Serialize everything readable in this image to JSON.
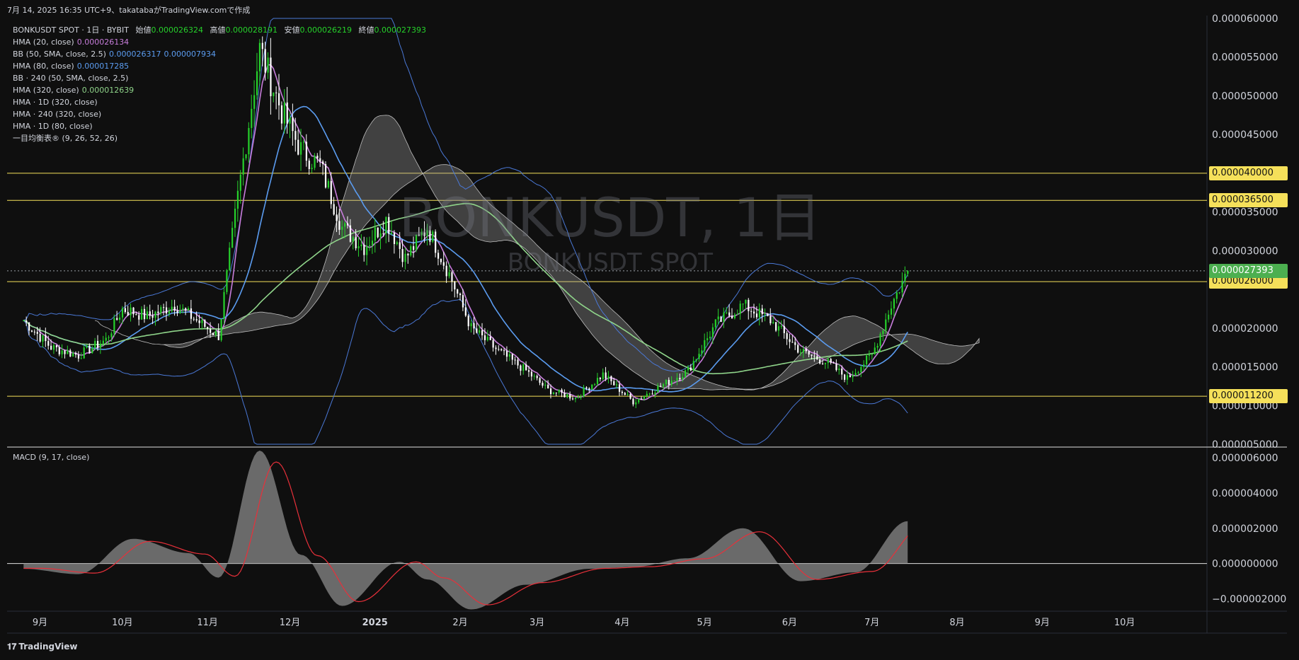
{
  "header": {
    "text": "7月 14, 2025 16:35 UTC+9、takatabaがTradingView.comで作成"
  },
  "legend": {
    "rows": [
      {
        "label": "BONKUSDT SPOT · 1日 · BYBIT",
        "parts": [
          {
            "label": "始値",
            "value": "0.000026324"
          },
          {
            "label": "高値",
            "value": "0.000028191"
          },
          {
            "label": "安値",
            "value": "0.000026219"
          },
          {
            "label": "終値",
            "value": "0.000027393"
          }
        ]
      },
      {
        "label": "HMA (20, close)",
        "value": "0.000026134",
        "color": "#c77ddb"
      },
      {
        "label": "BB (50, SMA, close, 2.5)",
        "value": "0.000026317",
        "value2": "0.000007934",
        "color": "#5b9cf0"
      },
      {
        "label": "HMA (80, close)",
        "value": "0.000017285",
        "color": "#5b9cf0"
      },
      {
        "label": "BB · 240 (50, SMA, close, 2.5)"
      },
      {
        "label": "HMA (320, close)",
        "value": "0.000012639",
        "color": "#8fd48a"
      },
      {
        "label": "HMA · 1D (320, close)"
      },
      {
        "label": "HMA · 240 (320, close)"
      },
      {
        "label": "HMA · 1D (80, close)"
      },
      {
        "label": "一目均衡表® (9, 26, 52, 26)"
      }
    ]
  },
  "macd_legend": "MACD (9, 17, close)",
  "watermark": {
    "line1": "BONKUSDT, 1日",
    "line2": "BONKUSDT SPOT"
  },
  "colors": {
    "up": "#26d12b",
    "down": "#ffffff",
    "hma20": "#c77ddb",
    "hma80": "#5b9cf0",
    "hma320": "#8fd48a",
    "bb": "#4a78d6",
    "level": "#f5e05a",
    "macd_signal": "#e8303a",
    "macd_hist": "#8a8a8a",
    "current_tag": "#4caf50"
  },
  "chart_data": {
    "type": "candlestick",
    "ylabel_ticks": [
      "0.000060000",
      "0.000055000",
      "0.000050000",
      "0.000045000",
      "0.000035000",
      "0.000030000",
      "0.000020000",
      "0.000015000",
      "0.000010000",
      "0.000005000"
    ],
    "x_ticks": [
      "9月",
      "10月",
      "11月",
      "12月",
      "2025",
      "2月",
      "3月",
      "4月",
      "5月",
      "6月",
      "7月",
      "8月",
      "9月",
      "10月"
    ],
    "ylim": [
      5e-06,
      6e-05
    ],
    "levels": [
      {
        "value": 4e-05,
        "label": "0.000040000"
      },
      {
        "value": 3.65e-05,
        "label": "0.000036500"
      },
      {
        "value": 2.6e-05,
        "label": "0.000026000"
      },
      {
        "value": 1.12e-05,
        "label": "0.000011200"
      }
    ],
    "current_price": {
      "value": 2.7393e-05,
      "label": "0.000027393"
    },
    "close_path": [
      [
        "2024-08-26",
        2.1e-05
      ],
      [
        "2024-09-05",
        1.75e-05
      ],
      [
        "2024-09-15",
        1.65e-05
      ],
      [
        "2024-09-25",
        1.85e-05
      ],
      [
        "2024-10-01",
        2.25e-05
      ],
      [
        "2024-10-10",
        2.15e-05
      ],
      [
        "2024-10-20",
        2.3e-05
      ],
      [
        "2024-10-30",
        2.05e-05
      ],
      [
        "2024-11-05",
        1.9e-05
      ],
      [
        "2024-11-12",
        3.7e-05
      ],
      [
        "2024-11-20",
        5.6e-05
      ],
      [
        "2024-11-28",
        4.8e-05
      ],
      [
        "2024-12-05",
        4.3e-05
      ],
      [
        "2024-12-12",
        4.1e-05
      ],
      [
        "2024-12-20",
        3.3e-05
      ],
      [
        "2024-12-28",
        3.05e-05
      ],
      [
        "2025-01-05",
        3.4e-05
      ],
      [
        "2025-01-12",
        2.9e-05
      ],
      [
        "2025-01-20",
        3.3e-05
      ],
      [
        "2025-01-28",
        2.7e-05
      ],
      [
        "2025-02-05",
        2e-05
      ],
      [
        "2025-02-15",
        1.7e-05
      ],
      [
        "2025-02-25",
        1.45e-05
      ],
      [
        "2025-03-05",
        1.2e-05
      ],
      [
        "2025-03-15",
        1.1e-05
      ],
      [
        "2025-03-25",
        1.4e-05
      ],
      [
        "2025-04-05",
        1.05e-05
      ],
      [
        "2025-04-15",
        1.25e-05
      ],
      [
        "2025-04-25",
        1.45e-05
      ],
      [
        "2025-05-05",
        2.05e-05
      ],
      [
        "2025-05-15",
        2.3e-05
      ],
      [
        "2025-05-25",
        2.1e-05
      ],
      [
        "2025-06-05",
        1.7e-05
      ],
      [
        "2025-06-15",
        1.55e-05
      ],
      [
        "2025-06-22",
        1.35e-05
      ],
      [
        "2025-07-01",
        1.65e-05
      ],
      [
        "2025-07-08",
        2.3e-05
      ],
      [
        "2025-07-14",
        2.74e-05
      ]
    ],
    "macd": {
      "yticks": [
        "0.000006000",
        "0.000004000",
        "0.000002000",
        "0.000000000",
        "−0.000002000"
      ],
      "ylim": [
        -2.7e-06,
        6.6e-06
      ],
      "hist": [
        [
          "2024-08-26",
          -3e-07
        ],
        [
          "2024-09-15",
          -6e-07
        ],
        [
          "2024-10-05",
          1.4e-06
        ],
        [
          "2024-10-25",
          6e-07
        ],
        [
          "2024-11-05",
          -8e-07
        ],
        [
          "2024-11-20",
          6.4e-06
        ],
        [
          "2024-12-05",
          5e-07
        ],
        [
          "2024-12-20",
          -2.4e-06
        ],
        [
          "2025-01-10",
          1e-07
        ],
        [
          "2025-01-20",
          -9e-07
        ],
        [
          "2025-02-05",
          -2.6e-06
        ],
        [
          "2025-02-25",
          -1.2e-06
        ],
        [
          "2025-03-20",
          -3e-07
        ],
        [
          "2025-04-05",
          -2e-07
        ],
        [
          "2025-04-25",
          3e-07
        ],
        [
          "2025-05-15",
          2e-06
        ],
        [
          "2025-06-05",
          -1e-06
        ],
        [
          "2025-06-25",
          -5e-07
        ],
        [
          "2025-07-14",
          2.4e-06
        ]
      ]
    }
  }
}
